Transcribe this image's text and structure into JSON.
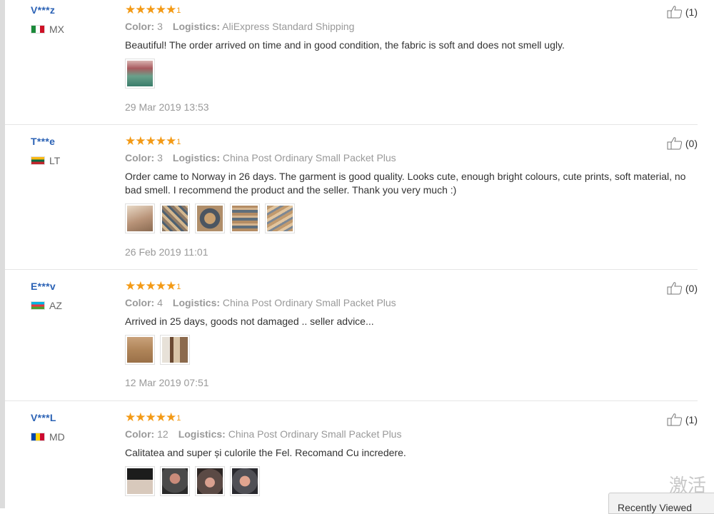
{
  "reviews": [
    {
      "user": "V***z",
      "country": "MX",
      "flag_colors": [
        "#1b8a3a",
        "#ffffff",
        "#ce1126"
      ],
      "stars": "★★★★★",
      "star_tick": "1",
      "color_label": "Color:",
      "color_value": "3",
      "logistics_label": "Logistics:",
      "logistics_value": "AliExpress Standard Shipping",
      "text": "Beautiful! The order arrived on time and in good condition, the fabric is soft and does not smell ugly.",
      "photo_count": 1,
      "date": "29 Mar 2019 13:53",
      "helpful_count": "(1)"
    },
    {
      "user": "T***e",
      "country": "LT",
      "flag_colors": [
        "#fdb913",
        "#006a44",
        "#c1272d"
      ],
      "stars": "★★★★★",
      "star_tick": "1",
      "color_label": "Color:",
      "color_value": "3",
      "logistics_label": "Logistics:",
      "logistics_value": "China Post Ordinary Small Packet Plus",
      "text": "Order came to Norway in 26 days. The garment is good quality. Looks cute, enough bright colours, cute prints, soft material, no bad smell. I recommend the product and the seller. Thank you very much :)",
      "photo_count": 5,
      "date": "26 Feb 2019 11:01",
      "helpful_count": "(0)"
    },
    {
      "user": "E***v",
      "country": "AZ",
      "flag_colors": [
        "#00b5e2",
        "#ef3340",
        "#509e2f"
      ],
      "stars": "★★★★★",
      "star_tick": "1",
      "color_label": "Color:",
      "color_value": "4",
      "logistics_label": "Logistics:",
      "logistics_value": "China Post Ordinary Small Packet Plus",
      "text": "Arrived in 25 days, goods not damaged .. seller advice...",
      "photo_count": 2,
      "date": "12 Mar 2019 07:51",
      "helpful_count": "(0)"
    },
    {
      "user": "V***L",
      "country": "MD",
      "flag_colors": [
        "#0046ae",
        "#ffd200",
        "#cc092f"
      ],
      "stars": "★★★★★",
      "star_tick": "1",
      "color_label": "Color:",
      "color_value": "12",
      "logistics_label": "Logistics:",
      "logistics_value": "China Post Ordinary Small Packet Plus",
      "text": "Calitatea and super și culorile the Fel. Recomand Cu incredere.",
      "photo_count": 4,
      "date": "",
      "helpful_count": "(1)"
    }
  ],
  "watermark": "激活",
  "recently_viewed": "Recently Viewed"
}
